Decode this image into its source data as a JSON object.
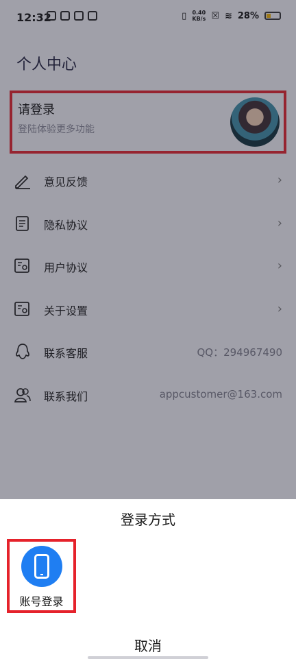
{
  "status_bar": {
    "time": "12:32",
    "speed_top": "0.40",
    "speed_unit": "KB/s",
    "battery": "28%"
  },
  "page": {
    "title": "个人中心"
  },
  "login_card": {
    "title": "请登录",
    "subtitle": "登陆体验更多功能"
  },
  "menu": {
    "items": [
      {
        "label": "意见反馈",
        "icon": "edit-icon"
      },
      {
        "label": "隐私协议",
        "icon": "document-icon"
      },
      {
        "label": "用户协议",
        "icon": "id-card-icon"
      },
      {
        "label": "关于设置",
        "icon": "id-card-icon"
      },
      {
        "label": "联系客服",
        "icon": "qq-icon",
        "value": "QQ：294967490"
      },
      {
        "label": "联系我们",
        "icon": "users-icon",
        "value": "appcustomer@163.com"
      }
    ],
    "chevron": "›"
  },
  "sheet": {
    "title": "登录方式",
    "option_label": "账号登录",
    "cancel": "取消"
  },
  "colors": {
    "highlight": "#e5222b",
    "accent": "#1f7ef2"
  }
}
